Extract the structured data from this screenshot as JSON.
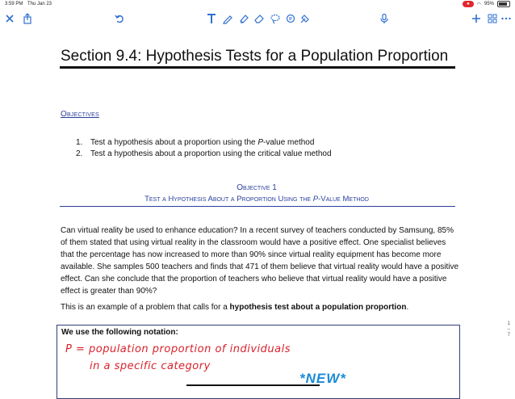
{
  "status": {
    "time": "3:59 PM",
    "date": "Thu Jan 23",
    "battery": "95%",
    "recording_label": "●"
  },
  "toolbar": {
    "icons": [
      "close-icon",
      "share-icon",
      "undo-icon",
      "text-tool-icon",
      "pen-icon",
      "highlighter-icon",
      "eraser-icon",
      "lasso-icon",
      "shapes-icon",
      "image-icon",
      "microphone-icon",
      "add-icon",
      "grid-icon",
      "more-icon"
    ]
  },
  "doc": {
    "title": "Section 9.4: Hypothesis Tests for a Population Proportion",
    "objectives_heading": "Objectives",
    "objectives": [
      {
        "num": "1.",
        "pre": "Test a hypothesis about a proportion using the ",
        "em": "P",
        "post": "-value method"
      },
      {
        "num": "2.",
        "pre": "Test a hypothesis about a proportion using the critical value method",
        "em": "",
        "post": ""
      }
    ],
    "objective1_title": "Objective 1",
    "objective1_sub_pre": "Test a Hypothesis About a Proportion Using the ",
    "objective1_sub_em": "P",
    "objective1_sub_post": "-Value Method",
    "paragraph": "Can virtual reality be used to enhance education? In a recent survey of teachers conducted by Samsung, 85% of them stated that using virtual reality in the classroom would have a positive effect. One specialist believes that the percentage has now increased to more than 90% since virtual reality equipment has become more available. She samples 500 teachers and finds that 471 of them believe that virtual reality would have a positive effect. Can she conclude that the proportion of teachers who believe that virtual reality would have a positive effect is greater than 90%?",
    "paragraph2_pre": "This is an example of a problem that calls for a ",
    "paragraph2_bold": "hypothesis test about a population proportion",
    "paragraph2_post": ".",
    "notation_heading": "We use the following notation:",
    "handwriting_line1": "P = population proportion of individuals",
    "handwriting_line2": "in a specific category",
    "new_tag": "*NEW*"
  },
  "scroll": {
    "current": "1",
    "total": "7"
  },
  "colors": {
    "accent": "#2f6fd0",
    "heading": "#2a3f9c",
    "ink_red": "#d8222b",
    "ink_blue": "#1a8bd9"
  }
}
